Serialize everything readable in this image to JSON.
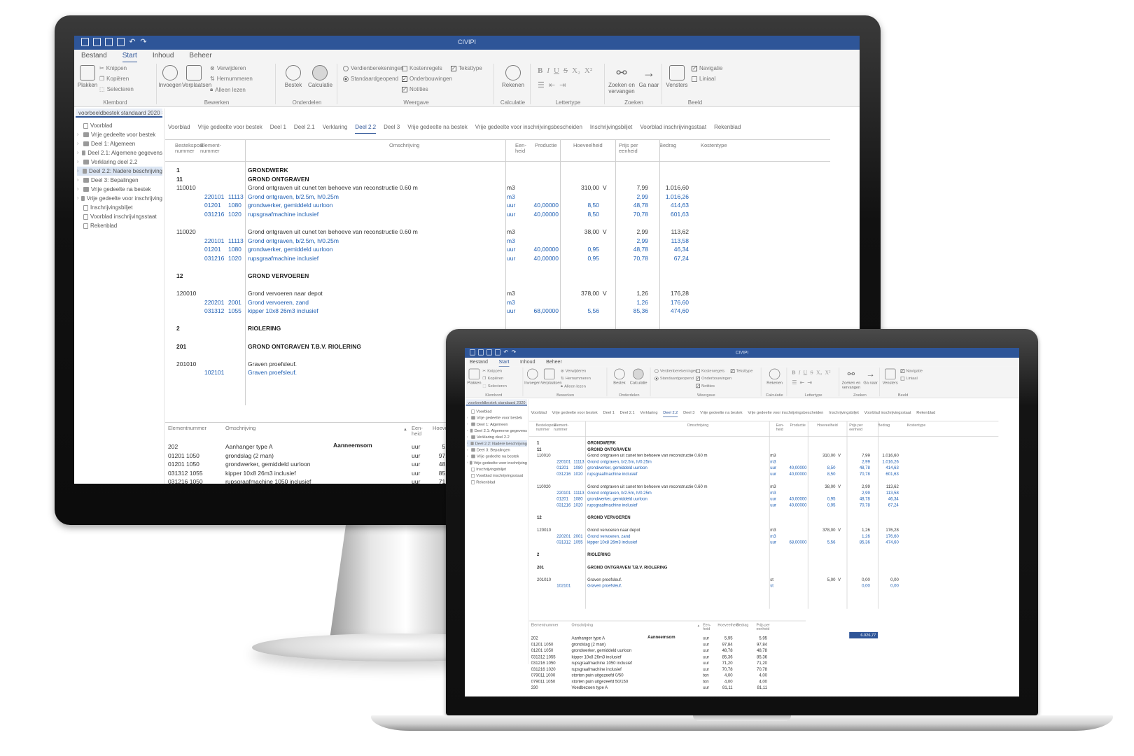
{
  "app": {
    "title": "CIVIPI",
    "menu": [
      "Bestand",
      "Start",
      "Inhoud",
      "Beheer"
    ],
    "active_menu": 1
  },
  "ribbon": {
    "klembord": {
      "label": "Klembord",
      "plakken": "Plakken",
      "knippen": "Knippen",
      "kopieren": "Kopiëren",
      "selecteren": "Selecteren"
    },
    "bewerken": {
      "label": "Bewerken",
      "invoegen": "Invoegen",
      "verplaatsen": "Verplaatsen",
      "verwijderen": "Verwijderen",
      "hernummeren": "Hernummeren",
      "alleen_lezen": "Alleen lezen"
    },
    "onderdelen": {
      "label": "Onderdelen",
      "bestek": "Bestek",
      "calculatie": "Calculatie"
    },
    "weergave": {
      "label": "Weergave",
      "verdienberekening": "Verdienberekeningen",
      "standaardgeopend": "Standaardgeopend",
      "kostenregels": "Kostenregels",
      "onderbouwingen": "Onderbouwingen",
      "notities": "Notities",
      "teksttype": "Teksttype"
    },
    "calculatie": {
      "label": "Calculatie",
      "rekenen": "Rekenen"
    },
    "lettertype": {
      "label": "Lettertype"
    },
    "zoeken": {
      "label": "Zoeken",
      "zoeken_en_vervangen": "Zoeken en vervangen",
      "ga_naar": "Ga naar"
    },
    "beeld": {
      "label": "Beeld",
      "vensters": "Vensters",
      "navigatie": "Navigatie",
      "linieaal": "Liniaal"
    }
  },
  "document_tab": "voorbeeldbestek standaard 2020",
  "tree": [
    {
      "label": "Voorblad",
      "type": "doc",
      "expand": false
    },
    {
      "label": "Vrije gedeelte voor bestek",
      "type": "folder",
      "expand": true
    },
    {
      "label": "Deel 1: Algemeen",
      "type": "folder",
      "expand": true
    },
    {
      "label": "Deel 2.1: Algemene gegevens",
      "type": "folder",
      "expand": true
    },
    {
      "label": "Verklaring deel 2.2",
      "type": "folder",
      "expand": true
    },
    {
      "label": "Deel 2.2: Nadere beschrijving",
      "type": "folder",
      "expand": true,
      "selected": true
    },
    {
      "label": "Deel 3: Bepalingen",
      "type": "folder",
      "expand": true
    },
    {
      "label": "Vrije gedeelte na bestek",
      "type": "folder",
      "expand": true
    },
    {
      "label": "Vrije gedeelte voor inschrijving",
      "type": "folder",
      "expand": true
    },
    {
      "label": "Inschrijvingsbiljet",
      "type": "doc",
      "expand": false
    },
    {
      "label": "Voorblad inschrijvingsstaat",
      "type": "doc",
      "expand": false
    },
    {
      "label": "Rekenblad",
      "type": "doc",
      "expand": false
    }
  ],
  "section_tabs": [
    "Voorblad",
    "Vrije gedeelte voor bestek",
    "Deel 1",
    "Deel 2.1",
    "Verklaring",
    "Deel 2.2",
    "Deel 3",
    "Vrije gedeelte na bestek",
    "Vrije gedeelte voor inschrijvingsbescheiden",
    "Inschrijvingsbiljet",
    "Voorblad inschrijvingsstaat",
    "Rekenblad"
  ],
  "active_section": 5,
  "grid": {
    "headers": {
      "bestek_post": "Bestekspost-\nnummer",
      "element": "Element-\nnummer",
      "omschrijving": "Omschrijving",
      "eenheid": "Een-\nheid",
      "productie": "Productie",
      "hoeveelheid": "Hoeveelheid",
      "prijs": "Prijs per\neenheid",
      "bedrag": "Bedrag",
      "kostentype": "Kostentype"
    },
    "rows": [
      {
        "style": "head",
        "post": "1",
        "desc": "GRONDWERK"
      },
      {
        "style": "head",
        "post": "11",
        "desc": "GROND ONTGRAVEN"
      },
      {
        "style": "normal",
        "post": "110010",
        "desc": "Grond ontgraven uit cunet ten behoeve van reconstructie 0.60 m",
        "unit": "m3",
        "qty": "310,00",
        "v": "V",
        "price": "7,99",
        "amount": "1.016,60"
      },
      {
        "style": "blue",
        "code1": "220101",
        "code2": "11113",
        "desc": "Grond ontgraven, b/2.5m, h/0.25m",
        "unit": "m3",
        "price": "2,99",
        "amount": "1.016,26"
      },
      {
        "style": "blue",
        "code1": "01201",
        "code2": "1080",
        "desc": "grondwerker, gemiddeld uurloon",
        "unit": "uur",
        "prod": "40,00000",
        "qty": "8,50",
        "price": "48,78",
        "amount": "414,63"
      },
      {
        "style": "blue",
        "code1": "031216",
        "code2": "1020",
        "desc": "rupsgraafmachine inclusief",
        "unit": "uur",
        "prod": "40,00000",
        "qty": "8,50",
        "price": "70,78",
        "amount": "601,63"
      },
      {
        "style": "gap"
      },
      {
        "style": "normal",
        "post": "110020",
        "desc": "Grond ontgraven uit cunet ten behoeve van reconstructie 0.60 m",
        "unit": "m3",
        "qty": "38,00",
        "v": "V",
        "price": "2,99",
        "amount": "113,62"
      },
      {
        "style": "blue",
        "code1": "220101",
        "code2": "11113",
        "desc": "Grond ontgraven, b/2.5m, h/0.25m",
        "unit": "m3",
        "price": "2,99",
        "amount": "113,58"
      },
      {
        "style": "blue",
        "code1": "01201",
        "code2": "1080",
        "desc": "grondwerker, gemiddeld uurloon",
        "unit": "uur",
        "prod": "40,00000",
        "qty": "0,95",
        "price": "48,78",
        "amount": "46,34"
      },
      {
        "style": "blue",
        "code1": "031216",
        "code2": "1020",
        "desc": "rupsgraafmachine inclusief",
        "unit": "uur",
        "prod": "40,00000",
        "qty": "0,95",
        "price": "70,78",
        "amount": "67,24"
      },
      {
        "style": "gap"
      },
      {
        "style": "head",
        "post": "12",
        "desc": "GROND VERVOEREN"
      },
      {
        "style": "gap"
      },
      {
        "style": "normal",
        "post": "120010",
        "desc": "Grond vervoeren naar depot",
        "unit": "m3",
        "qty": "378,00",
        "v": "V",
        "price": "1,26",
        "amount": "176,28"
      },
      {
        "style": "blue",
        "code1": "220201",
        "code2": "2001",
        "desc": "Grond vervoeren, zand",
        "unit": "m3",
        "price": "1,26",
        "amount": "176,60"
      },
      {
        "style": "blue",
        "code1": "031312",
        "code2": "1055",
        "desc": "kipper 10x8 26m3 inclusief",
        "unit": "uur",
        "prod": "68,00000",
        "qty": "5,56",
        "price": "85,36",
        "amount": "474,60"
      },
      {
        "style": "gap"
      },
      {
        "style": "head",
        "post": "2",
        "desc": "RIOLERING"
      },
      {
        "style": "gap"
      },
      {
        "style": "head",
        "post": "201",
        "desc": "GROND ONTGRAVEN T.B.V. RIOLERING"
      },
      {
        "style": "gap"
      },
      {
        "style": "normal",
        "post": "201010",
        "desc": "Graven proefsleuf.",
        "unit": "st",
        "qty": "5,00",
        "v": "V",
        "price": "0,00",
        "amount": "0,00"
      },
      {
        "style": "blue",
        "code1": "102101",
        "desc": "Graven proefsleuf.",
        "unit": "st",
        "price": "0,00",
        "amount": "0,00"
      }
    ],
    "total_label": "Aanneemsom",
    "total_value": "6.026,77"
  },
  "bottom_panel": {
    "headers": {
      "code": "Elementnummer",
      "desc": "Omschrijving",
      "unit": "Een-\nheid",
      "qty": "Hoeveelheid",
      "bedrag": "Bedrag",
      "prijs": "Prijs per\neenheid"
    },
    "rows": [
      {
        "code": "202",
        "desc": "Aanhanger type A",
        "unit": "uur",
        "qty": "5,95",
        "price": "5,95"
      },
      {
        "code": "01201  1050",
        "desc": "grondslag (2 man)",
        "unit": "uur",
        "qty": "97,84",
        "price": "97,84"
      },
      {
        "code": "01201  1050",
        "desc": "grondwerker, gemiddeld uurloon",
        "unit": "uur",
        "qty": "48,78",
        "price": "48,78"
      },
      {
        "code": "031312 1055",
        "desc": "kipper 10x8 26m3 inclusief",
        "unit": "uur",
        "qty": "85,36",
        "price": "85,36"
      },
      {
        "code": "031216 1050",
        "desc": "rupsgraafmachine 1050 inclusief",
        "unit": "uur",
        "qty": "71,20",
        "price": "71,20"
      },
      {
        "code": "031216 1020",
        "desc": "rupsgraafmachine inclusief",
        "unit": "uur",
        "qty": "70,78",
        "price": "70,78"
      },
      {
        "code": "079011 1000",
        "desc": "storten puin uitgezeefd 0/50",
        "unit": "ton",
        "qty": "4,00",
        "price": "4,00"
      },
      {
        "code": "079011 1050",
        "desc": "storten puin uitgezeefd 50/150",
        "unit": "ton",
        "qty": "4,00",
        "price": "4,00"
      },
      {
        "code": "330",
        "desc": "Voedbezoen type A",
        "unit": "uur",
        "qty": "81,11",
        "price": "81,11"
      }
    ]
  },
  "colors": {
    "accent": "#2e5598",
    "blue_text": "#1f5fb3"
  }
}
